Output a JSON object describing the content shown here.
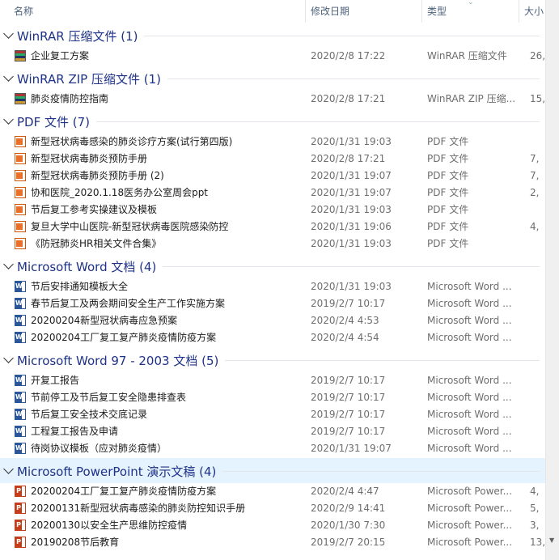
{
  "header": {
    "name": "名称",
    "date": "修改日期",
    "type": "类型",
    "size": "大小"
  },
  "groups": [
    {
      "title": "WinRAR 压缩文件 (1)",
      "icon": "archive-icon",
      "files": [
        {
          "name": "企业复工方案",
          "date": "2020/2/8 17:22",
          "type": "WinRAR 压缩文件",
          "size": "26,"
        }
      ]
    },
    {
      "title": "WinRAR ZIP 压缩文件 (1)",
      "icon": "archive-icon",
      "files": [
        {
          "name": "肺炎疫情防控指南",
          "date": "2020/2/8 17:21",
          "type": "WinRAR ZIP 压缩...",
          "size": "15,0"
        }
      ]
    },
    {
      "title": "PDF 文件 (7)",
      "icon": "pdf-icon",
      "files": [
        {
          "name": "新型冠状病毒感染的肺炎诊疗方案(试行第四版)",
          "date": "2020/1/31 19:03",
          "type": "PDF 文件",
          "size": ""
        },
        {
          "name": "新型冠状病毒肺炎预防手册",
          "date": "2020/2/8 17:21",
          "type": "PDF 文件",
          "size": "7,"
        },
        {
          "name": "新型冠状病毒肺炎预防手册 (2)",
          "date": "2020/1/31 19:07",
          "type": "PDF 文件",
          "size": "7,"
        },
        {
          "name": "协和医院_2020.1.18医务办公室周会ppt",
          "date": "2020/1/31 19:07",
          "type": "PDF 文件",
          "size": "2,"
        },
        {
          "name": "节后复工参考实操建议及模板",
          "date": "2020/1/31 19:03",
          "type": "PDF 文件",
          "size": ""
        },
        {
          "name": "复旦大学中山医院-新型冠状病毒医院感染防控",
          "date": "2020/1/31 19:06",
          "type": "PDF 文件",
          "size": "4,"
        },
        {
          "name": "《防冠肺炎HR相关文件合集》",
          "date": "2020/1/31 19:03",
          "type": "PDF 文件",
          "size": ""
        }
      ]
    },
    {
      "title": "Microsoft Word 文档 (4)",
      "icon": "word-icon",
      "files": [
        {
          "name": "节后安排通知模板大全",
          "date": "2020/1/31 19:03",
          "type": "Microsoft Word ...",
          "size": ""
        },
        {
          "name": "春节后复工及两会期间安全生产工作实施方案",
          "date": "2019/2/7 10:17",
          "type": "Microsoft Word ...",
          "size": ""
        },
        {
          "name": "20200204新型冠状病毒应急预案",
          "date": "2020/2/4 4:53",
          "type": "Microsoft Word ...",
          "size": ""
        },
        {
          "name": "20200204工厂复工复产肺炎疫情防疫方案",
          "date": "2020/2/4 4:54",
          "type": "Microsoft Word ...",
          "size": ""
        }
      ]
    },
    {
      "title": "Microsoft Word 97 - 2003 文档 (5)",
      "icon": "word-icon",
      "files": [
        {
          "name": "开复工报告",
          "date": "2019/2/7 10:17",
          "type": "Microsoft Word ...",
          "size": ""
        },
        {
          "name": "节前停工及节后复工安全隐患排查表",
          "date": "2019/2/7 10:17",
          "type": "Microsoft Word ...",
          "size": ""
        },
        {
          "name": "节后复工安全技术交底记录",
          "date": "2019/2/7 10:17",
          "type": "Microsoft Word ...",
          "size": ""
        },
        {
          "name": "工程复工报告及申请",
          "date": "2019/2/7 10:17",
          "type": "Microsoft Word ...",
          "size": ""
        },
        {
          "name": "待岗协议模板（应对肺炎疫情）",
          "date": "2020/1/31 19:07",
          "type": "Microsoft Word ...",
          "size": ""
        }
      ]
    },
    {
      "title": "Microsoft PowerPoint 演示文稿 (4)",
      "icon": "powerpoint-icon",
      "selected": true,
      "files": [
        {
          "name": "20200204工厂复工复产肺炎疫情防疫方案",
          "date": "2020/2/4 4:47",
          "type": "Microsoft Power...",
          "size": "4,"
        },
        {
          "name": "20200131新型冠状病毒感染的肺炎防控知识手册",
          "date": "2020/2/9 14:41",
          "type": "Microsoft Power...",
          "size": "5,"
        },
        {
          "name": "20200130以安全生产思维防控疫情",
          "date": "2020/1/30 7:30",
          "type": "Microsoft Power...",
          "size": "3,"
        },
        {
          "name": "20190208节后教育",
          "date": "2019/2/7 20:15",
          "type": "Microsoft Power...",
          "size": "13,"
        }
      ]
    }
  ]
}
